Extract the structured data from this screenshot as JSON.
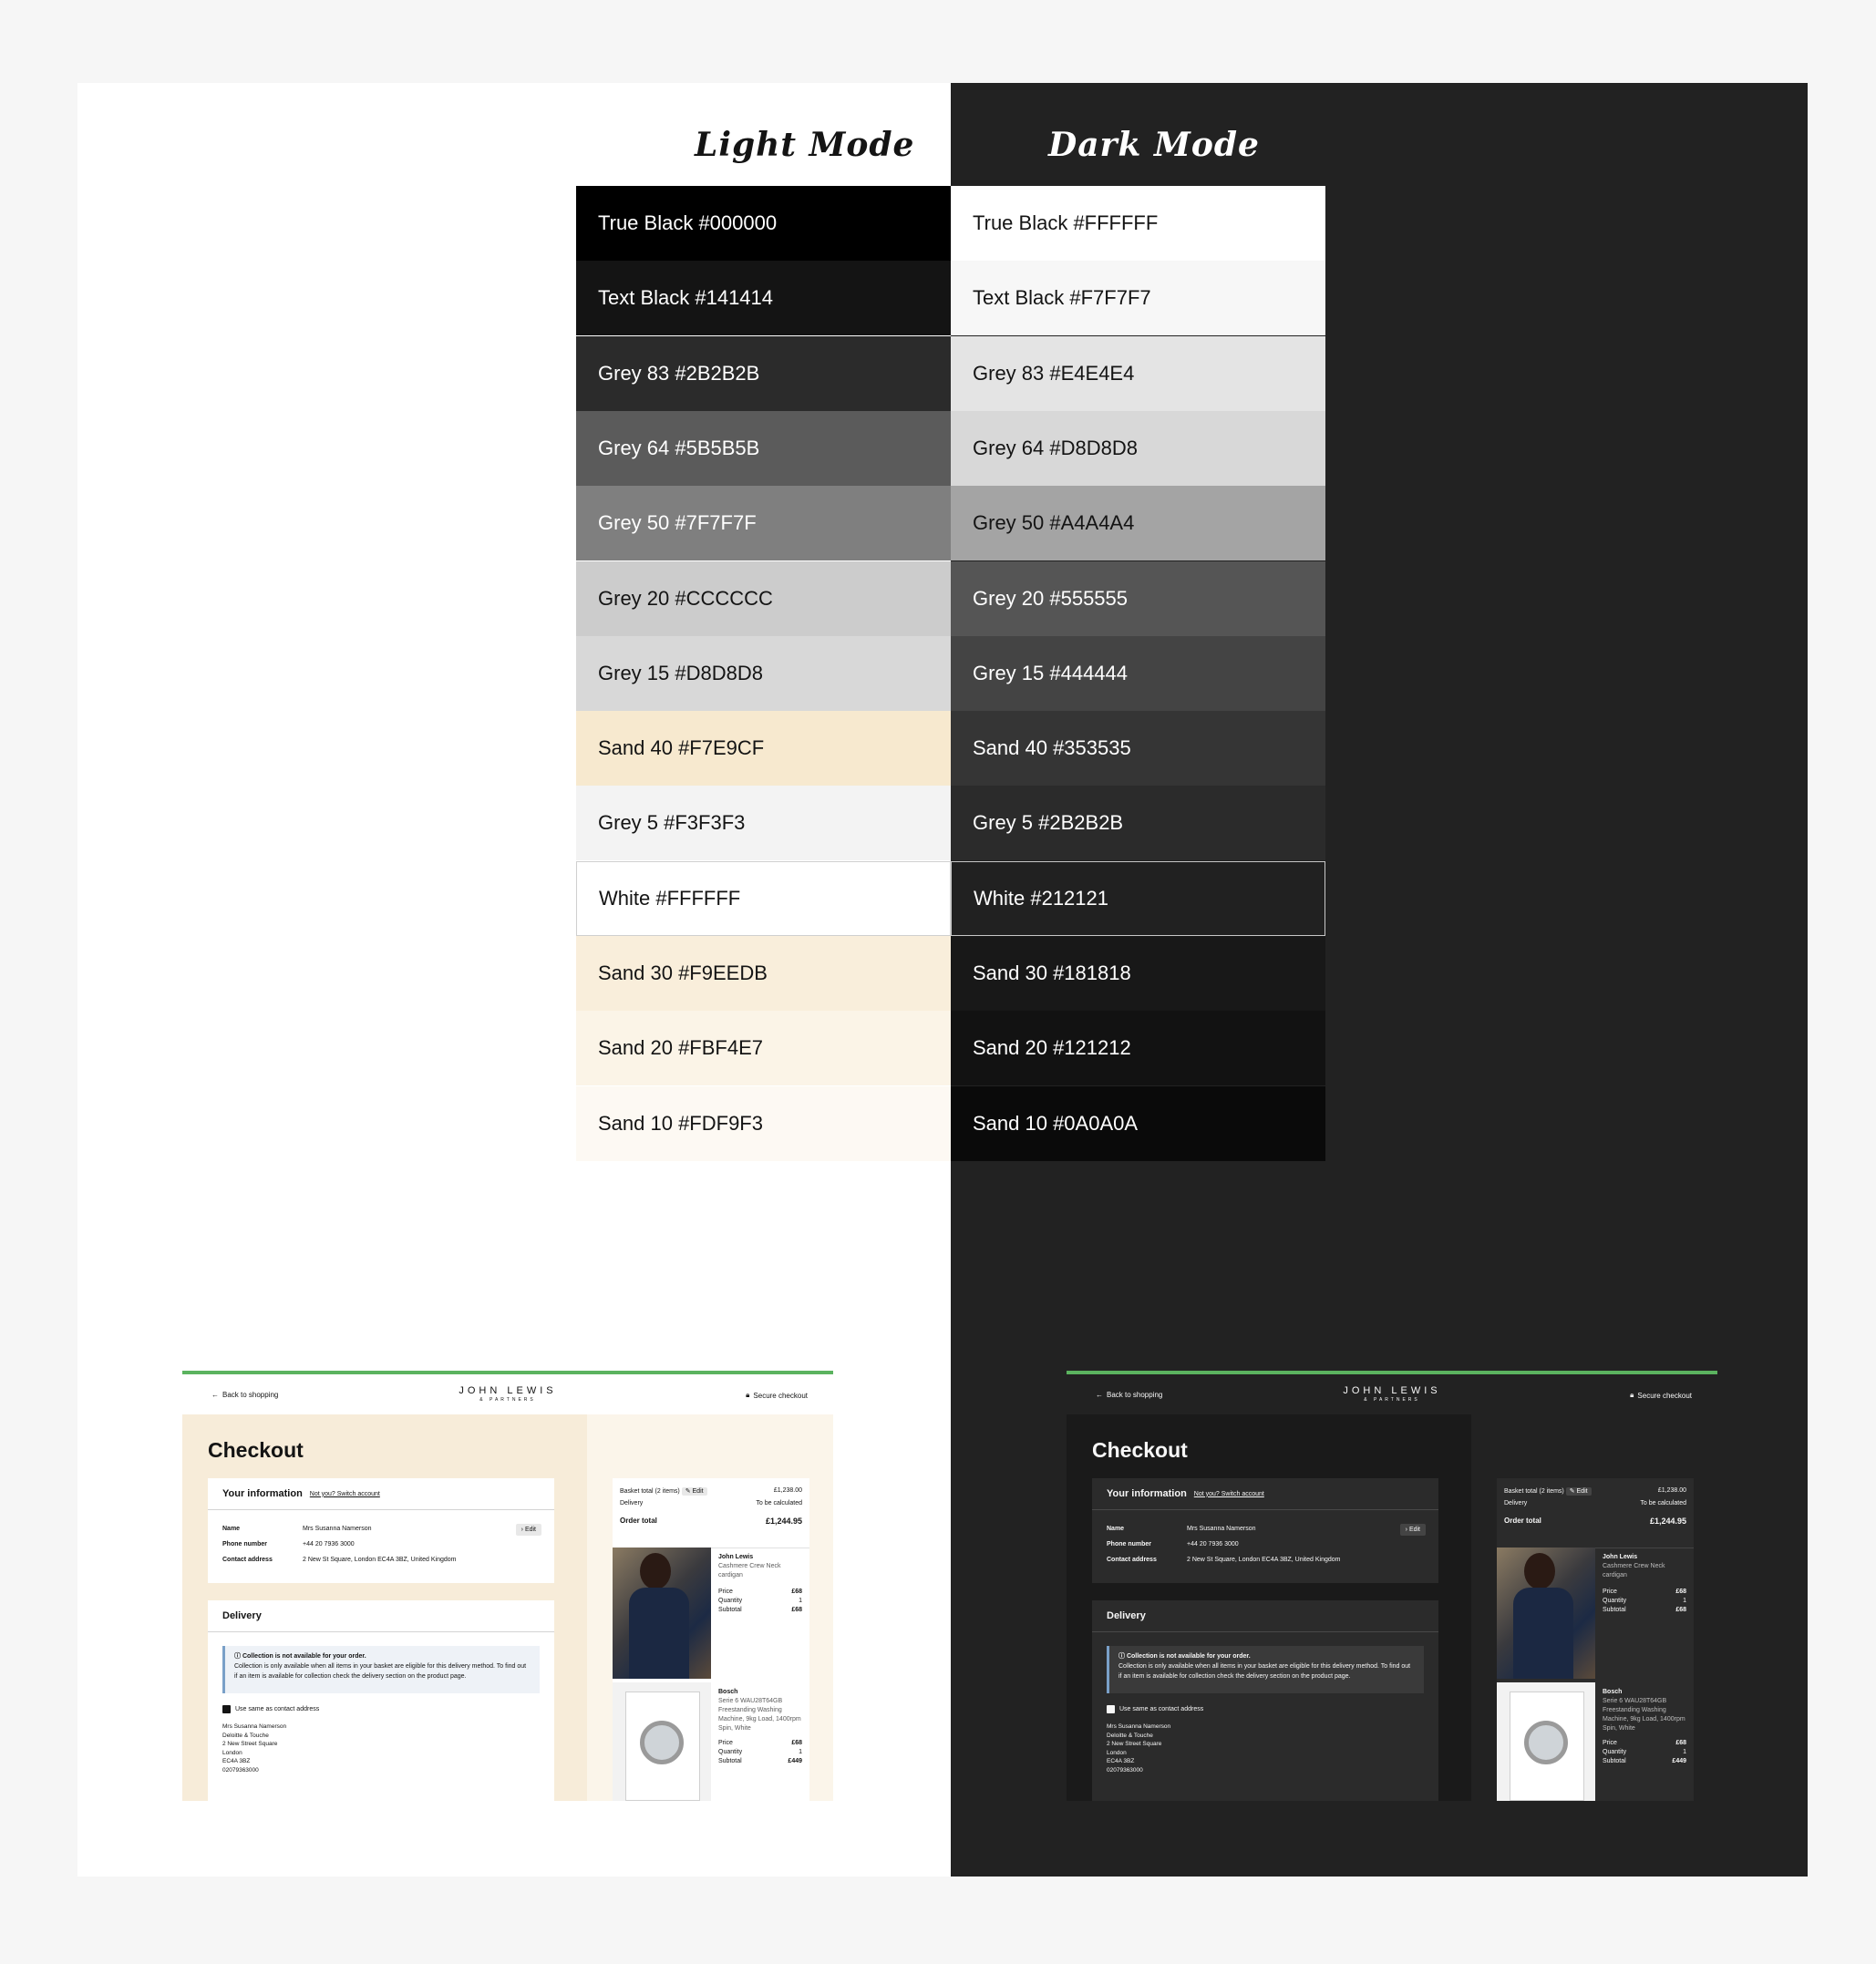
{
  "headings": {
    "light": "Light Mode",
    "dark": "Dark Mode"
  },
  "light_swatches": [
    {
      "label": "True Black #000000",
      "bg": "#000000",
      "fg": "#ffffff"
    },
    {
      "label": "Text Black #141414",
      "bg": "#141414",
      "fg": "#ffffff"
    },
    {
      "label": "Grey 83 #2B2B2B",
      "bg": "#2B2B2B",
      "fg": "#ffffff"
    },
    {
      "label": "Grey 64 #5B5B5B",
      "bg": "#5B5B5B",
      "fg": "#ffffff"
    },
    {
      "label": "Grey 50 #7F7F7F",
      "bg": "#7F7F7F",
      "fg": "#ffffff"
    },
    {
      "label": "Grey 20 #CCCCCC",
      "bg": "#CCCCCC",
      "fg": "#141414"
    },
    {
      "label": "Grey 15 #D8D8D8",
      "bg": "#D8D8D8",
      "fg": "#141414"
    },
    {
      "label": "Sand 40 #F7E9CF",
      "bg": "#F7E9CF",
      "fg": "#141414"
    },
    {
      "label": "Grey 5 #F3F3F3",
      "bg": "#F3F3F3",
      "fg": "#141414"
    },
    {
      "label": "White #FFFFFF",
      "bg": "#FFFFFF",
      "fg": "#141414"
    },
    {
      "label": "Sand 30 #F9EEDB",
      "bg": "#F9EEDB",
      "fg": "#141414"
    },
    {
      "label": "Sand 20 #FBF4E7",
      "bg": "#FBF4E7",
      "fg": "#141414"
    },
    {
      "label": "Sand 10 #FDF9F3",
      "bg": "#FDF9F3",
      "fg": "#141414"
    }
  ],
  "dark_swatches": [
    {
      "label": "True Black #FFFFFF",
      "bg": "#FFFFFF",
      "fg": "#141414"
    },
    {
      "label": "Text Black #F7F7F7",
      "bg": "#F7F7F7",
      "fg": "#141414"
    },
    {
      "label": "Grey 83 #E4E4E4",
      "bg": "#E4E4E4",
      "fg": "#141414"
    },
    {
      "label": "Grey 64 #D8D8D8",
      "bg": "#D8D8D8",
      "fg": "#141414"
    },
    {
      "label": "Grey 50 #A4A4A4",
      "bg": "#A4A4A4",
      "fg": "#141414"
    },
    {
      "label": "Grey 20 #555555",
      "bg": "#555555",
      "fg": "#ffffff"
    },
    {
      "label": "Grey 15 #444444",
      "bg": "#444444",
      "fg": "#ffffff"
    },
    {
      "label": "Sand 40 #353535",
      "bg": "#353535",
      "fg": "#ffffff"
    },
    {
      "label": "Grey 5 #2B2B2B",
      "bg": "#2B2B2B",
      "fg": "#ffffff"
    },
    {
      "label": "White #212121",
      "bg": "#212121",
      "fg": "#ffffff"
    },
    {
      "label": "Sand 30 #181818",
      "bg": "#181818",
      "fg": "#ffffff"
    },
    {
      "label": "Sand 20 #121212",
      "bg": "#121212",
      "fg": "#ffffff"
    },
    {
      "label": "Sand 10 #0A0A0A",
      "bg": "#0A0A0A",
      "fg": "#ffffff"
    }
  ],
  "checkout": {
    "back": "Back to shopping",
    "logo": "JOHN LEWIS",
    "logo_sub": "& PARTNERS",
    "secure": "Secure checkout",
    "title": "Checkout",
    "info_title": "Your information",
    "switch_account": "Not you? Switch account",
    "name_label": "Name",
    "name_value": "Mrs Susanna Namerson",
    "phone_label": "Phone number",
    "phone_value": "+44 20 7936 3000",
    "contact_label": "Contact address",
    "contact_value": "2 New St Square, London EC4A 3BZ, United Kingdom",
    "edit": "Edit",
    "delivery_title": "Delivery",
    "notice_title": "Collection is not available for your order.",
    "notice_body": "Collection is only available when all items in your basket are eligible for this delivery method. To find out if an item is available for collection check the delivery section on the product page.",
    "same_address": "Use same as contact address",
    "address_lines": "Mrs Susanna Namerson\nDeloitte & Touche\n2 New Street Square\nLondon\nEC4A 3BZ\n02079363000",
    "basket_total_label": "Basket total (2 items)",
    "basket_total_value": "£1,238.00",
    "delivery_label": "Delivery",
    "delivery_value": "To be calculated",
    "order_total_label": "Order total",
    "order_total_value": "£1,244.95",
    "item1": {
      "brand": "John Lewis",
      "name": "Cashmere Crew Neck cardigan",
      "price_label": "Price",
      "price": "£68",
      "qty_label": "Quantity",
      "qty": "1",
      "subtotal_label": "Subtotal",
      "subtotal": "£68"
    },
    "item2": {
      "brand": "Bosch",
      "name": "Serie 6 WAU28T64GB Freestanding Washing Machine, 9kg Load, 1400rpm Spin, White",
      "price_label": "Price",
      "price": "£68",
      "qty_label": "Quantity",
      "qty": "1",
      "subtotal_label": "Subtotal",
      "subtotal": "£449"
    }
  }
}
